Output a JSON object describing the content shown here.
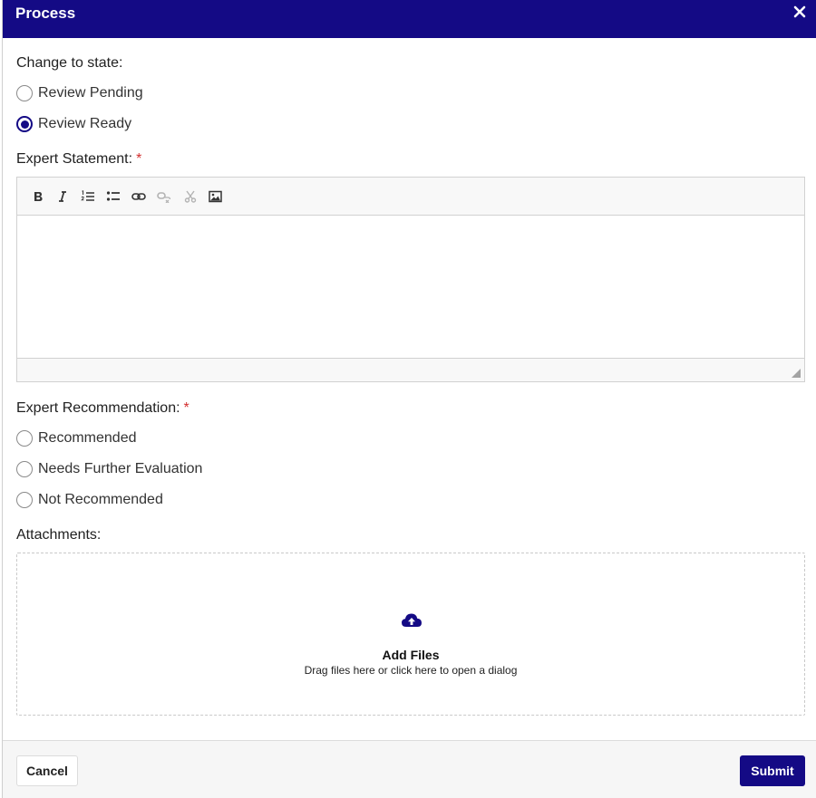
{
  "dialog": {
    "title": "Process",
    "close_icon": "close-icon"
  },
  "state": {
    "label": "Change to state:",
    "options": [
      {
        "label": "Review Pending",
        "checked": false
      },
      {
        "label": "Review Ready",
        "checked": true
      }
    ]
  },
  "statement": {
    "label": "Expert Statement:",
    "required_mark": "*",
    "toolbar": [
      {
        "icon": "bold-icon",
        "enabled": true
      },
      {
        "icon": "italic-icon",
        "enabled": true
      },
      {
        "icon": "numbered-list-icon",
        "enabled": true
      },
      {
        "icon": "bulleted-list-icon",
        "enabled": true
      },
      {
        "icon": "link-icon",
        "enabled": true
      },
      {
        "icon": "unlink-icon",
        "enabled": false
      },
      {
        "icon": "cut-icon",
        "enabled": false
      },
      {
        "icon": "image-icon",
        "enabled": true
      }
    ],
    "value": ""
  },
  "recommendation": {
    "label": "Expert Recommendation:",
    "required_mark": "*",
    "options": [
      {
        "label": "Recommended",
        "checked": false
      },
      {
        "label": "Needs Further Evaluation",
        "checked": false
      },
      {
        "label": "Not Recommended",
        "checked": false
      }
    ]
  },
  "attachments": {
    "label": "Attachments:",
    "icon": "cloud-upload-icon",
    "add_files": "Add Files",
    "hint": "Drag files here or click here to open a dialog"
  },
  "footer": {
    "cancel_label": "Cancel",
    "submit_label": "Submit"
  },
  "colors": {
    "primary": "#140a85",
    "required": "#d32f2f"
  }
}
